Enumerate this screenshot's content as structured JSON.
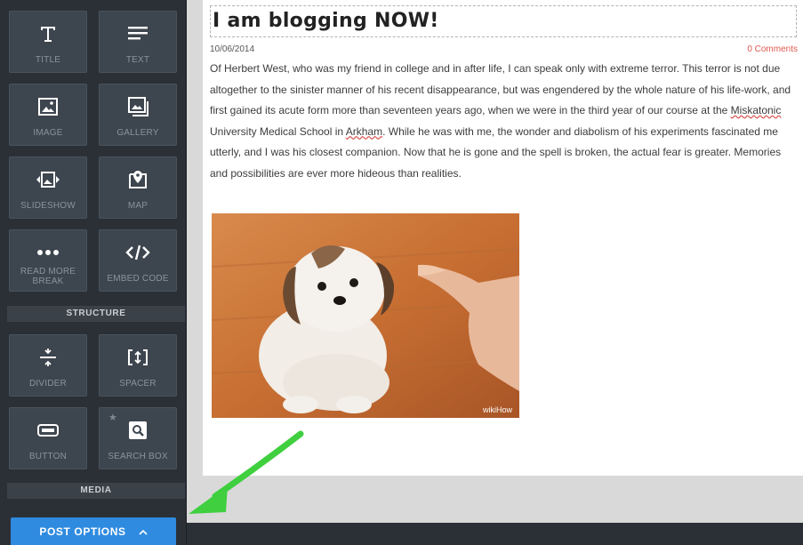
{
  "sidebar": {
    "tiles": [
      {
        "label": "TITLE",
        "icon": "title-icon"
      },
      {
        "label": "TEXT",
        "icon": "text-icon"
      },
      {
        "label": "IMAGE",
        "icon": "image-icon"
      },
      {
        "label": "GALLERY",
        "icon": "gallery-icon"
      },
      {
        "label": "SLIDESHOW",
        "icon": "slideshow-icon"
      },
      {
        "label": "MAP",
        "icon": "map-pin-icon"
      },
      {
        "label": "READ MORE BREAK",
        "icon": "ellipsis-icon"
      },
      {
        "label": "EMBED CODE",
        "icon": "code-icon"
      },
      {
        "label": "DIVIDER",
        "icon": "divider-icon"
      },
      {
        "label": "SPACER",
        "icon": "spacer-icon"
      },
      {
        "label": "BUTTON",
        "icon": "button-icon"
      },
      {
        "label": "SEARCH BOX",
        "icon": "search-icon"
      }
    ],
    "sections": {
      "structure": "STRUCTURE",
      "media": "MEDIA"
    },
    "post_options_label": "POST OPTIONS"
  },
  "post": {
    "title": "I am blogging NOW!",
    "date": "10/06/2014",
    "comments": "0 Comments",
    "body_part1": "Of Herbert West, who was my friend in college and in after life, I can speak only with extreme terror. This terror is not due altogether to the sinister manner of his recent disappearance, but was engendered by the whole nature of his life-work, and first gained its acute form more than seventeen years ago, when we were in the third year of our course at the ",
    "body_word1": "Miskatonic",
    "body_part2": " University Medical School in ",
    "body_word2": "Arkham",
    "body_part3": ". While he was with me, the wonder and diabolism of his experiments fascinated me utterly, and I was his closest companion. Now that he is gone and the spell is broken, the actual fear is greater. Memories and possibilities are ever more hideous than realities.",
    "image_watermark": "wikiHow"
  },
  "colors": {
    "sidebar_bg": "#2a3036",
    "tile_bg": "#3d454e",
    "accent_blue": "#2f8bdf",
    "comments_red": "#e0584f",
    "annotation_green": "#3fcf3f"
  }
}
